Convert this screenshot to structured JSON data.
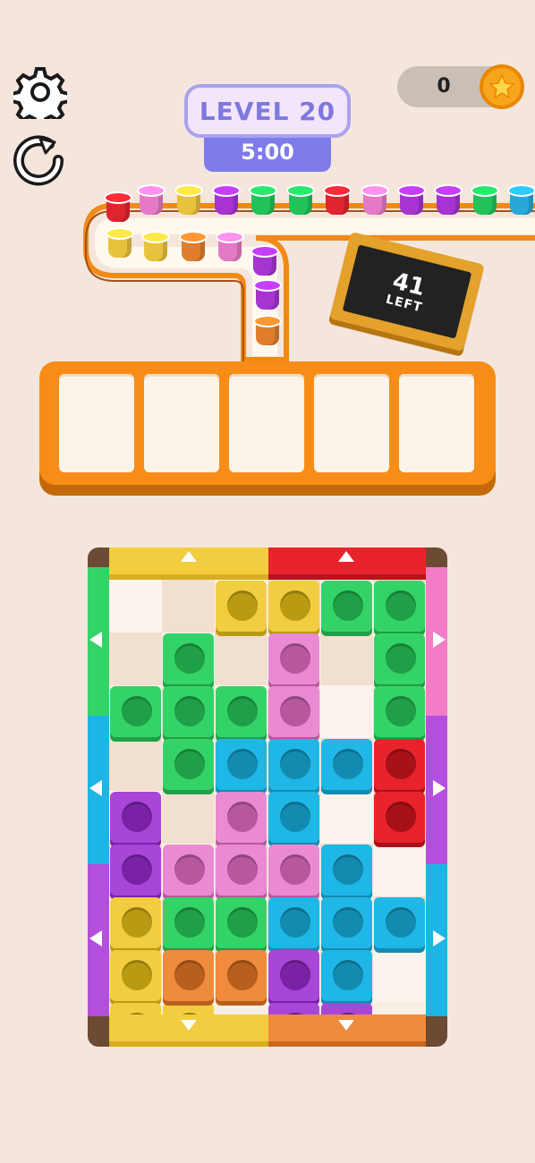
{
  "hud": {
    "level_label": "LEVEL 20",
    "timer": "5:00",
    "coins": "0",
    "icons": {
      "settings": "gear-icon",
      "restart": "restart-icon",
      "coin": "star-coin-icon"
    }
  },
  "sign": {
    "count": "41",
    "label": "LEFT"
  },
  "slots": {
    "count": 5
  },
  "cup_queue": [
    "red",
    "pink",
    "yellow",
    "purple",
    "green",
    "green",
    "red",
    "pink",
    "purple",
    "purple",
    "green",
    "blue",
    "yellow",
    "yellow",
    "orange",
    "pink",
    "purple",
    "purple",
    "orange"
  ],
  "board": {
    "gates": [
      "yellow-top",
      "red-top",
      "green-left",
      "blue-left",
      "purple-left",
      "pink-right",
      "purple-right",
      "blue-right",
      "yellow-bottom",
      "orange-bottom"
    ],
    "pieces": [
      "yellow",
      "green",
      "pink",
      "green-plus",
      "blue",
      "red",
      "purple",
      "pink-t",
      "yellow-l",
      "green-bar",
      "orange",
      "blue-plus",
      "purple-l"
    ]
  },
  "colors": {
    "background": "#f4e6dc",
    "tray": "#f78d17",
    "level_text": "#7e78df",
    "timer_bg": "#7f7bea"
  }
}
